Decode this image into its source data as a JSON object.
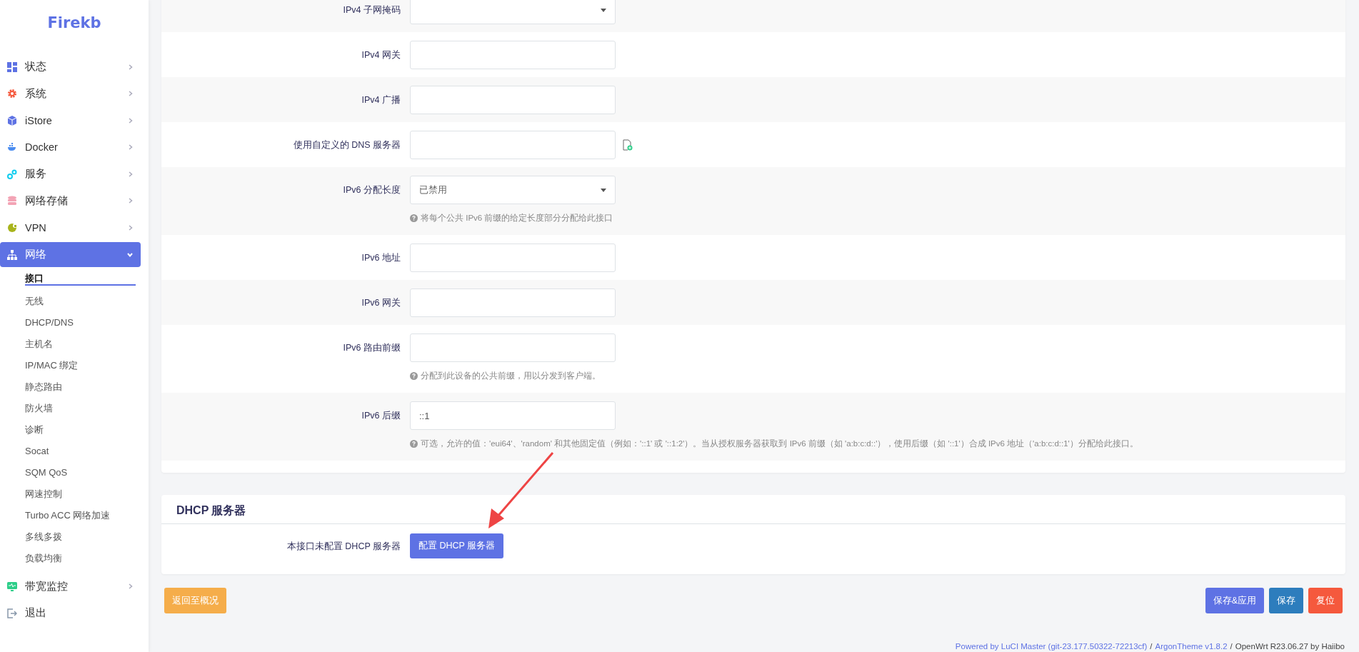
{
  "sidebar": {
    "logo": "Firekb",
    "items": [
      {
        "label": "状态",
        "expanded": false,
        "selected": false
      },
      {
        "label": "系统",
        "expanded": false,
        "selected": false
      },
      {
        "label": "iStore",
        "expanded": false,
        "selected": false
      },
      {
        "label": "Docker",
        "expanded": false,
        "selected": false
      },
      {
        "label": "服务",
        "expanded": false,
        "selected": false
      },
      {
        "label": "网络存储",
        "expanded": false,
        "selected": false
      },
      {
        "label": "VPN",
        "expanded": false,
        "selected": false
      },
      {
        "label": "网络",
        "expanded": true,
        "selected": true,
        "children": [
          {
            "label": "接口",
            "selected": true
          },
          {
            "label": "无线",
            "selected": false
          },
          {
            "label": "DHCP/DNS",
            "selected": false
          },
          {
            "label": "主机名",
            "selected": false
          },
          {
            "label": "IP/MAC 绑定",
            "selected": false
          },
          {
            "label": "静态路由",
            "selected": false
          },
          {
            "label": "防火墙",
            "selected": false
          },
          {
            "label": "诊断",
            "selected": false
          },
          {
            "label": "Socat",
            "selected": false
          },
          {
            "label": "SQM QoS",
            "selected": false
          },
          {
            "label": "网速控制",
            "selected": false
          },
          {
            "label": "Turbo ACC 网络加速",
            "selected": false
          },
          {
            "label": "多线多拨",
            "selected": false
          },
          {
            "label": "负载均衡",
            "selected": false
          }
        ]
      },
      {
        "label": "带宽监控",
        "expanded": false,
        "selected": false
      },
      {
        "label": "退出",
        "kind": "logout",
        "selected": false
      }
    ]
  },
  "form": {
    "rows": [
      {
        "label": "IPv4 子网掩码",
        "kind": "select",
        "value": "",
        "add_icon": false
      },
      {
        "label": "IPv4 网关",
        "kind": "text",
        "value": "",
        "add_icon": false
      },
      {
        "label": "IPv4 广播",
        "kind": "text",
        "value": "",
        "add_icon": false
      },
      {
        "label": "使用自定义的 DNS 服务器",
        "kind": "text",
        "value": "",
        "add_icon": true
      },
      {
        "label": "IPv6 分配长度",
        "kind": "select",
        "value": "已禁用",
        "add_icon": false,
        "hint": "将每个公共 IPv6 前缀的给定长度部分分配给此接口"
      },
      {
        "label": "IPv6 地址",
        "kind": "text",
        "value": "",
        "add_icon": false
      },
      {
        "label": "IPv6 网关",
        "kind": "text",
        "value": "",
        "add_icon": false
      },
      {
        "label": "IPv6 路由前缀",
        "kind": "text",
        "value": "",
        "add_icon": false,
        "hint": "分配到此设备的公共前缀，用以分发到客户端。"
      },
      {
        "label": "IPv6 后缀",
        "kind": "text",
        "value": "::1",
        "add_icon": false,
        "hint": "可选，允许的值：'eui64'、'random' 和其他固定值（例如：'::1' 或 '::1:2'）。当从授权服务器获取到 IPv6 前缀（如 'a:b:c:d::'），使用后缀（如 '::1'）合成 IPv6 地址（'a:b:c:d::1'）分配给此接口。"
      }
    ]
  },
  "dhcp_section": {
    "title": "DHCP 服务器",
    "label": "本接口未配置 DHCP 服务器",
    "button": "配置 DHCP 服务器"
  },
  "actions": {
    "back": "返回至概况",
    "buttons": [
      {
        "label": "保存&应用",
        "kind": "primary"
      },
      {
        "label": "保存",
        "kind": "info"
      },
      {
        "label": "复位",
        "kind": "danger"
      }
    ]
  },
  "footer": [
    {
      "text": "Powered by LuCI Master (git-23.177.50322-72213cf)",
      "kind": "link"
    },
    {
      "text": "/",
      "kind": "text"
    },
    {
      "text": "ArgonTheme v1.8.2",
      "kind": "link"
    },
    {
      "text": "/",
      "kind": "text"
    },
    {
      "text": "OpenWrt R23.06.27 by Haiibo",
      "kind": "text"
    }
  ]
}
